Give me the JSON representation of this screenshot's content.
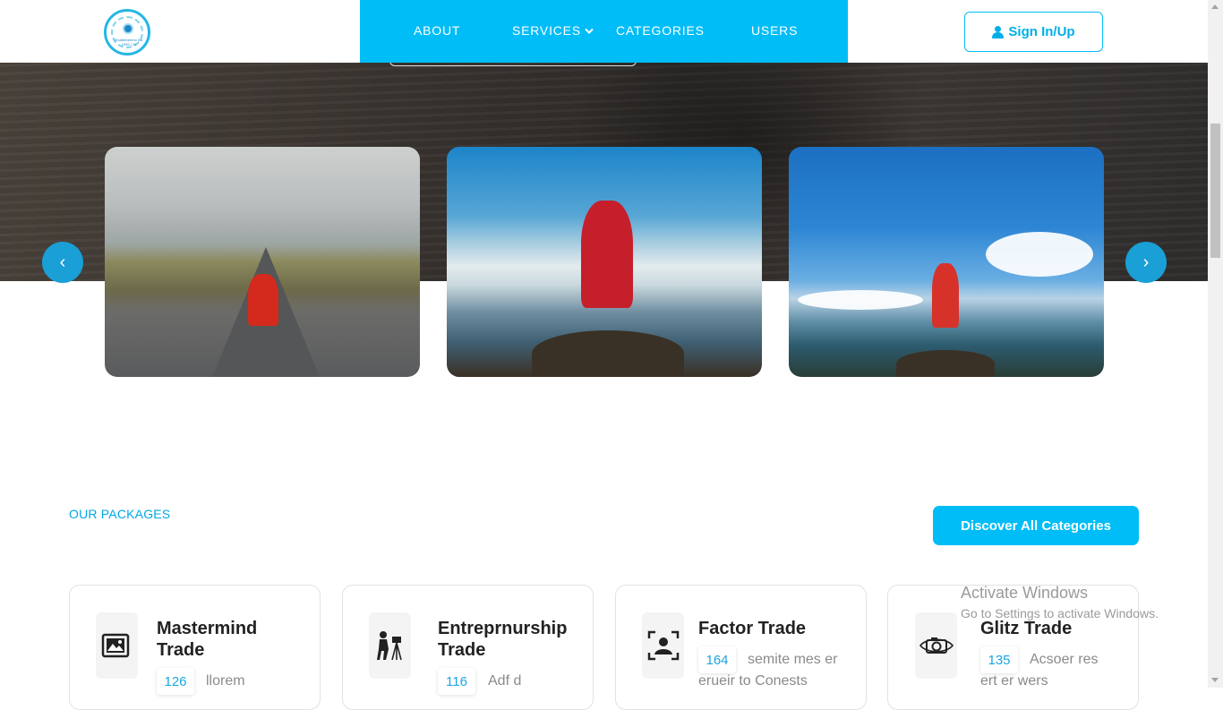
{
  "header": {
    "nav": [
      {
        "label": "ABOUT"
      },
      {
        "label": "SERVICES"
      },
      {
        "label": "CATEGORIES"
      },
      {
        "label": "USERS"
      }
    ],
    "signin_label": "Sign In/Up",
    "logo_text": "Shutterbeemo\nest. 1995 / 28"
  },
  "carousel": {
    "prev_glyph": "‹",
    "next_glyph": "›"
  },
  "packages": {
    "section_label": "OUR PACKAGES",
    "discover_label": "Discover All Categories",
    "cards": [
      {
        "title": "Mastermind Trade",
        "count": "126",
        "desc": "llorem",
        "icon": "photo-gallery-icon"
      },
      {
        "title": "Entreprnurship Trade",
        "count": "116",
        "desc": "Adf d",
        "icon": "photographer-tripod-icon"
      },
      {
        "title": "Factor Trade",
        "count": "164",
        "desc": "semite mes er",
        "desc2": "erueir to Conests",
        "icon": "portrait-frame-icon"
      },
      {
        "title": "Glitz Trade",
        "count": "135",
        "desc": "Acsoer res",
        "desc2": "ert er wers",
        "icon": "camera-icon"
      }
    ]
  },
  "watermark": {
    "title": "Activate Windows",
    "subtitle": "Go to Settings to activate Windows."
  },
  "colors": {
    "accent": "#00bdf7",
    "accent_text": "#00aee8",
    "carousel_button": "#1a9fd6"
  }
}
